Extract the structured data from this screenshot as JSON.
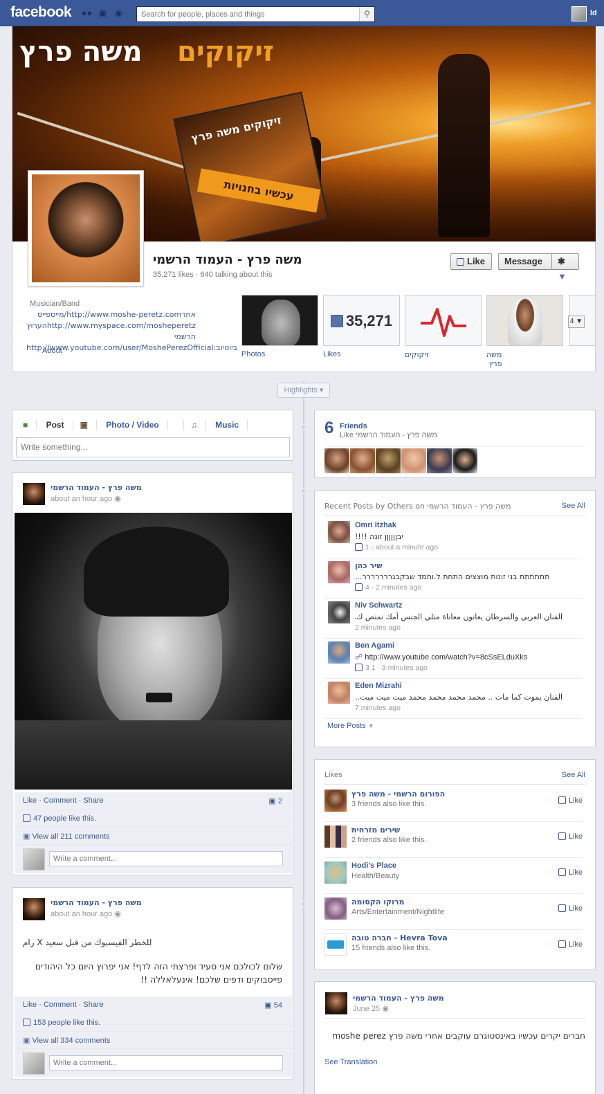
{
  "topbar": {
    "logo": "facebook",
    "search_placeholder": "Search for people, places and things",
    "user_name": "Id"
  },
  "header": {
    "cover_title_white": "משה פרץ",
    "cover_title_orange": "זיקוקים",
    "album_title": "זיקוקים משה פרץ",
    "album_band": "עכשיו בחנויות",
    "page_name": "משה פרץ - העמוד הרשמי",
    "stats": "35,271 likes · 640 talking about this",
    "like_button": "Like",
    "message_button": "Message",
    "about": {
      "category": "Musician/Band",
      "line1": "אתרhttp://www.moshe-peretz.com/מייספייס",
      "line2": "http://www.myspace.com/mosheperetzהערוץ הרשמי",
      "line3": "ביוטיוב:http://www.youtube.com/user/MoshePerezOfficial",
      "label": "About"
    },
    "tiles": [
      {
        "label": "Photos"
      },
      {
        "label": "Likes",
        "value": "35,271"
      },
      {
        "label": "זיקוקים"
      },
      {
        "label": "משה פרץ"
      }
    ],
    "expand_count": "4"
  },
  "highlights": "Highlights",
  "composer": {
    "tabs": [
      "Post",
      "Photo / Video",
      "Music"
    ],
    "placeholder": "Write something..."
  },
  "post1": {
    "author": "משה פרץ - העמוד הרשמי",
    "time": "about an hour ago",
    "actions": "Like · Comment · Share",
    "share_count": "2",
    "likes_text": "47 people like this.",
    "comments_text": "View all 211 comments",
    "comment_placeholder": "Write a comment..."
  },
  "post2": {
    "author": "משה פרץ - העמוד הרשמי",
    "time": "about an hour ago",
    "text1": "للخطر الفيسبوك من قبل سعيد X رام",
    "text2": "שלום לכולכם אני סעיד ופרצתי הזה לדף! אני יפרוץ היום כל היהודים פייסבוקים ודפים שלכם! אינעלאללה !!",
    "actions": "Like · Comment · Share",
    "share_count": "54",
    "likes_text": "153 people like this.",
    "comments_text": "View all 334 comments",
    "comment_placeholder": "Write a comment..."
  },
  "friends": {
    "count": "6",
    "title": "Friends",
    "subtitle": "Like משה פרץ - העמוד הרשמי"
  },
  "recent_posts": {
    "title": "Recent Posts by Others on משה פרץ - העמוד הרשמי",
    "see_all": "See All",
    "items": [
      {
        "name": "Omri Itzhak",
        "text": "יבןןןןןן זונה !!!!",
        "meta": "1 · about a minute ago"
      },
      {
        "name": "שיר כהן",
        "text": "תתתתתת בני זונות מוצצים התחת ל.וחמד שבקבגררררררר...",
        "meta": "4 · 2 minutes ago"
      },
      {
        "name": "Niv Schwartz",
        "text": "الفنان العربي والسرطان يعانون معاناة مثلي الجنس أمك تمتص ك...",
        "meta": "2 minutes ago"
      },
      {
        "name": "Ben Agami",
        "text": "http://www.youtube.com/watch?v=8cSsELduXks",
        "meta": "3  1 · 3 minutes ago"
      },
      {
        "name": "Eden Mizrahi",
        "text": "الفنان يموت كما مات .. محمد محمد محمد محمد ميت ميت ميت...",
        "meta": "7 minutes ago"
      }
    ],
    "more": "More Posts"
  },
  "likes_box": {
    "title": "Likes",
    "see_all": "See All",
    "like_label": "Like",
    "items": [
      {
        "name": "הפורום הרשמי - משה פרץ",
        "sub": "3 friends also like this."
      },
      {
        "name": "שירים מזרחית",
        "sub": "2 friends also like this."
      },
      {
        "name": "Hodi's Place",
        "sub": "Health/Beauty"
      },
      {
        "name": "מרוקו הקסומה",
        "sub": "Arts/Entertainment/Nightlife"
      },
      {
        "name": "חברה טובה - Hevra Tova",
        "sub": "15 friends also like this."
      }
    ]
  },
  "post3": {
    "author": "משה פרץ - העמוד הרשמי",
    "time": "June 25",
    "text": "חברים יקרים עכשיו באינסטוגרם עוקבים אחרי משה פרץ moshe perez",
    "see_translation": "See Translation"
  }
}
